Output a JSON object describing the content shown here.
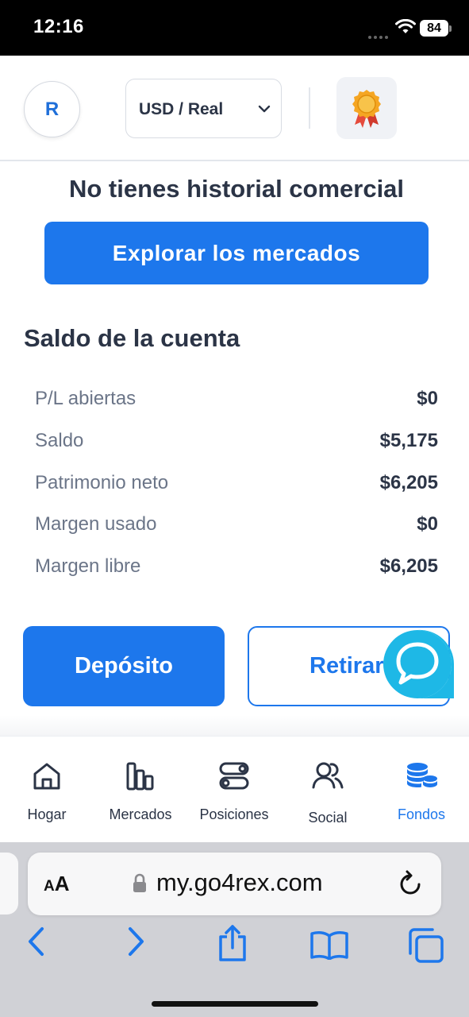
{
  "status_bar": {
    "time": "12:16",
    "battery": "84"
  },
  "header": {
    "avatar_initial": "R",
    "account_type": "USD / Real",
    "badge_icon": "award-medal-icon"
  },
  "main": {
    "empty_history_message": "No tienes historial comercial",
    "explore_button": "Explorar los mercados",
    "balance_title": "Saldo de la cuenta",
    "balance_rows": [
      {
        "label": "P/L abiertas",
        "value": "$0"
      },
      {
        "label": "Saldo",
        "value": "$5,175"
      },
      {
        "label": "Patrimonio neto",
        "value": "$6,205"
      },
      {
        "label": "Margen usado",
        "value": "$0"
      },
      {
        "label": "Margen libre",
        "value": "$6,205"
      }
    ],
    "deposit_button": "Depósito",
    "withdraw_button": "Retirar",
    "chat_icon": "chat-bubble-icon"
  },
  "bottom_nav": {
    "items": [
      {
        "label": "Hogar",
        "icon": "home-icon",
        "active": false
      },
      {
        "label": "Mercados",
        "icon": "bar-chart-icon",
        "active": false
      },
      {
        "label": "Posiciones",
        "icon": "toggles-icon",
        "active": false
      },
      {
        "label": "Social",
        "icon": "users-icon",
        "active": false
      },
      {
        "label": "Fondos",
        "icon": "coins-stack-icon",
        "active": true
      }
    ]
  },
  "browser": {
    "text_size_label": "AA",
    "url": "my.go4rex.com",
    "toolbar_icons": [
      "back-arrow-icon",
      "forward-arrow-icon",
      "share-icon",
      "bookmarks-icon",
      "tabs-icon"
    ]
  },
  "colors": {
    "accent": "#1d77ec",
    "text_dark": "#2b3446",
    "text_muted": "#6b7588",
    "chat_teal": "#1eb8e6"
  }
}
